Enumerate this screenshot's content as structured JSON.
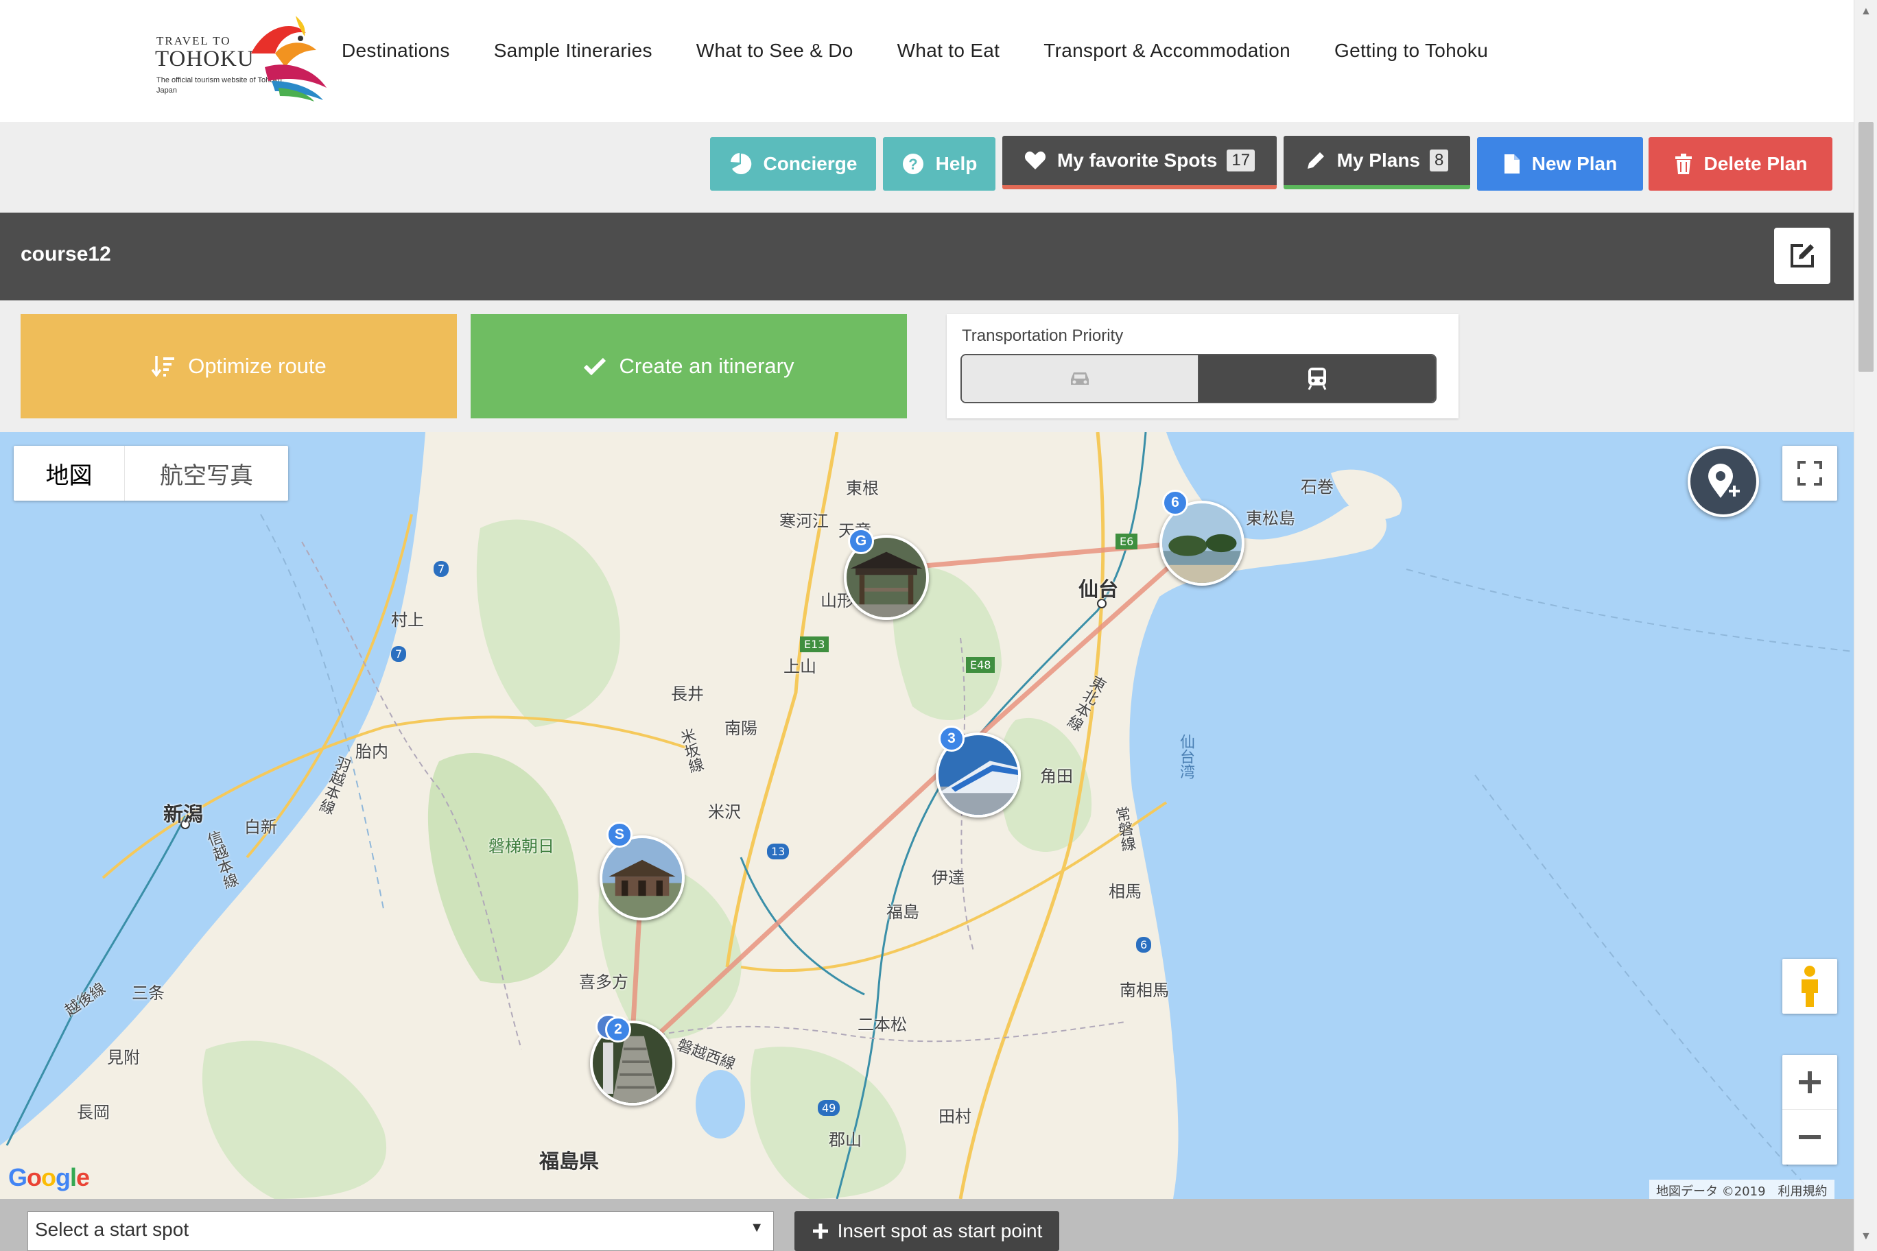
{
  "header": {
    "logo": {
      "line1": "TRAVEL TO",
      "line2": "TOHOKU",
      "line3": "The official tourism website of Tohoku, Japan"
    },
    "nav": [
      "Destinations",
      "Sample Itineraries",
      "What to See & Do",
      "What to Eat",
      "Transport & Accommodation",
      "Getting to Tohoku"
    ]
  },
  "toolbar": {
    "concierge": "Concierge",
    "help": "Help",
    "favorites": {
      "label": "My favorite Spots",
      "count": "17"
    },
    "plans": {
      "label": "My Plans",
      "count": "8"
    },
    "new_plan": "New Plan",
    "delete_plan": "Delete Plan"
  },
  "course": {
    "title": "course12"
  },
  "actions": {
    "optimize": "Optimize route",
    "create": "Create an itinerary",
    "transport_label": "Transportation Priority",
    "transport_options": [
      "car",
      "train"
    ],
    "transport_selected": "train"
  },
  "map": {
    "type_buttons": [
      "地図",
      "航空写真"
    ],
    "labels": {
      "niigata": "新潟",
      "sendai": "仙台",
      "fukushima_pref": "福島県",
      "tone": "東根",
      "sagae": "寒河江",
      "tendo": "天童",
      "yamagata": "山形",
      "kaminoyama": "上山",
      "nagai": "長井",
      "nanyo": "南陽",
      "yonezawa": "米沢",
      "murakami": "村上",
      "tainai": "胎内",
      "shirone": "白新",
      "bandai_asahi": "磐梯朝日",
      "kitakata": "喜多方",
      "fukushima": "福島",
      "date": "伊達",
      "kakuda": "角田",
      "soma": "相馬",
      "minamisoma": "南相馬",
      "nihonmatsu": "二本松",
      "tamura": "田村",
      "koriyama": "郡山",
      "sanjo": "三条",
      "mitsuke": "見附",
      "nagaoka": "長岡",
      "ishinomaki": "石巻",
      "higashimatsushima": "東松島",
      "sendai_bay": "仙台湾",
      "line_uetsu": "羽越本線",
      "line_shinetsu": "信越本線",
      "line_yonesaka": "米坂線",
      "line_tohoku": "東北本線",
      "line_joban": "常磐線",
      "line_banetsu": "磐越西線",
      "line_etsugo": "越後線",
      "rt7": "7",
      "rt13": "13",
      "rt6": "6",
      "rt49": "49",
      "e13": "E13",
      "e48": "E48",
      "e6": "E6"
    },
    "spots": [
      {
        "badge": "S",
        "photo": "temple-hall"
      },
      {
        "badge": "2",
        "photo": "stone-stairs"
      },
      {
        "badge": "3",
        "photo": "shinkansen-train"
      },
      {
        "badge": "6",
        "photo": "pine-island-coast"
      },
      {
        "badge": "G",
        "photo": "wooden-pavilion"
      }
    ],
    "google": "Google",
    "attribution": "地図データ ©2019　利用規約"
  },
  "bottom": {
    "select_placeholder": "Select a start spot",
    "insert_button": "Insert spot as start point"
  },
  "colors": {
    "teal": "#5bbcbc",
    "dark": "#4d4d4d",
    "blue": "#3d85e6",
    "red": "#e2534f",
    "yellow": "#efbd59",
    "green": "#6fbd62",
    "route": "#e8937f",
    "water": "#aad3f7",
    "land": "#f3efe4"
  }
}
